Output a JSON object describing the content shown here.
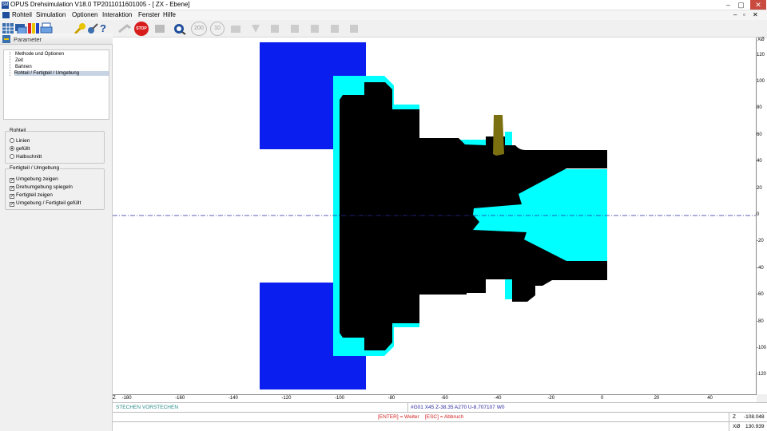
{
  "window": {
    "title": "OPUS Drehsimulation V18.0  TP2011011601005    - [  ZX - Ebene]",
    "app_icon_text": "SM",
    "min_glyph": "–",
    "max_glyph": "▢",
    "close_glyph": "✕"
  },
  "menu": {
    "items": [
      "Rohteil",
      "Simulation",
      "Optionen",
      "Interaktion",
      "Fenster",
      "Hilfe"
    ],
    "doc_min": "–",
    "doc_max": "▫",
    "doc_close": "✕"
  },
  "toolbar": {
    "help_glyph": "?",
    "stop_label": "STOP",
    "speed_200": "200",
    "speed_10": "10",
    "icons": [
      "grid-icon",
      "layers-icon",
      "palette-icon",
      "print-icon",
      "wrench-icon",
      "key-icon",
      "help-icon",
      "pointer-icon",
      "stop-icon",
      "run-icon",
      "camera-icon",
      "speed-200-icon",
      "speed-10-icon",
      "step-icon",
      "tool-icon",
      "tool-icon",
      "tool-icon",
      "tool-icon",
      "tool-icon",
      "tool-icon",
      "tool-icon"
    ]
  },
  "sidebar": {
    "header_label": "Parameter",
    "tree": [
      "Methode und Optionen",
      "Zeit",
      "Bahnen",
      "Rohteil / Fertigteil / Umgebung"
    ],
    "rohteil": {
      "legend": "Rohteil",
      "options": [
        {
          "label": "Linien",
          "checked": false
        },
        {
          "label": "gefüllt",
          "checked": true
        },
        {
          "label": "Halbschnitt",
          "checked": false
        }
      ]
    },
    "fertigteil": {
      "legend": "Fertigteil / Umgebung",
      "options": [
        {
          "label": "Umgebung zeigen",
          "checked": true
        },
        {
          "label": "Drehumgebung spiegeln",
          "checked": true
        },
        {
          "label": "Fertigteil zeigen",
          "checked": true
        },
        {
          "label": "Umgebung / Fertigteil gefüllt",
          "checked": true
        }
      ]
    },
    "check_glyph": "✓"
  },
  "canvas": {
    "colors": {
      "chuck": "#0a1ef0",
      "stock": "#00ffff",
      "part": "#000000",
      "tool": "#7a7010",
      "centerline": "#2a2aa0"
    },
    "x_axis": {
      "label": "Z",
      "ticks": [
        -180,
        -160,
        -140,
        -120,
        -100,
        -80,
        -60,
        -40,
        -20,
        0,
        20,
        40
      ]
    },
    "y_axis": {
      "label": "XØ",
      "ticks": [
        120,
        100,
        80,
        60,
        40,
        20,
        0,
        -20,
        -40,
        -60,
        -80,
        -100,
        -120
      ]
    }
  },
  "status": {
    "mode": "STECHEN VORSTECHEN",
    "nc_line": "#G01 X45 Z-38.35 A270 U-8.707107 W0",
    "hint": "[ENTER] = Weiter    [ESC] = Abbruch",
    "z_label": "Z",
    "z_value": "-108.048",
    "x_label": "XØ",
    "x_value": "130.939"
  }
}
